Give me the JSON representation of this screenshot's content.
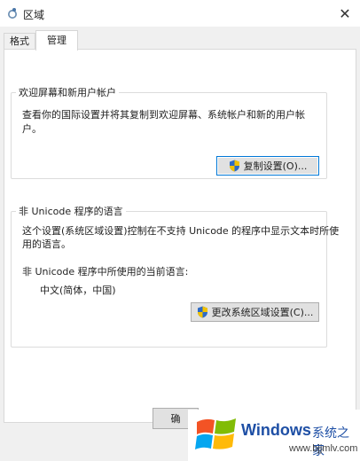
{
  "window": {
    "title": "区域"
  },
  "tabs": [
    {
      "label": "格式"
    },
    {
      "label": "管理"
    }
  ],
  "welcome_group": {
    "legend": "欢迎屏幕和新用户帐户",
    "description": "查看你的国际设置并将其复制到欢迎屏幕、系统帐户和新的用户帐户。",
    "copy_button": "复制设置(O)..."
  },
  "non_unicode_group": {
    "legend": "非 Unicode 程序的语言",
    "description_line1": "这个设置(系统区域设置)控制在不支持 Unicode 的程序中显示文本时所使",
    "description_line2": "用的语言。",
    "current_label": "非 Unicode 程序中所使用的当前语言:",
    "current_value": "中文(简体，中国)",
    "change_button": "更改系统区域设置(C)..."
  },
  "footer": {
    "ok_button": "确"
  },
  "watermark": {
    "windows": "Windows",
    "brand": "系统之家",
    "url": "www.bjjmlv.com"
  }
}
